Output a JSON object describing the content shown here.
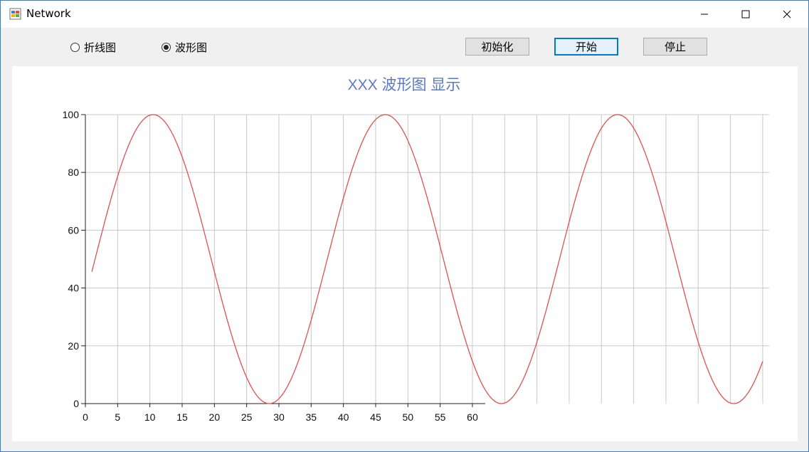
{
  "window": {
    "title": "Network",
    "icons": {
      "app": "app-window-icon",
      "minimize": "minimize-icon",
      "maximize": "maximize-icon",
      "close": "close-icon"
    }
  },
  "toolbar": {
    "radio_line": {
      "label": "折线图",
      "checked": false
    },
    "radio_wave": {
      "label": "波形图",
      "checked": true
    },
    "init_label": "初始化",
    "start_label": "开始",
    "stop_label": "停止"
  },
  "chart_data": {
    "type": "line",
    "title": "XXX 波形图 显示",
    "xlabel": "",
    "ylabel": "",
    "xlim": [
      0,
      106
    ],
    "ylim": [
      0,
      100
    ],
    "x_ticks": [
      0,
      5,
      10,
      15,
      20,
      25,
      30,
      35,
      40,
      45,
      50,
      55,
      60
    ],
    "y_ticks": [
      0,
      20,
      40,
      60,
      80,
      100
    ],
    "grid": true,
    "series": [
      {
        "color": "#e05050",
        "function": "50 + 50*sin(2*pi*(x - 1.5)/36)",
        "x_start": 1,
        "x_end": 105
      }
    ]
  }
}
